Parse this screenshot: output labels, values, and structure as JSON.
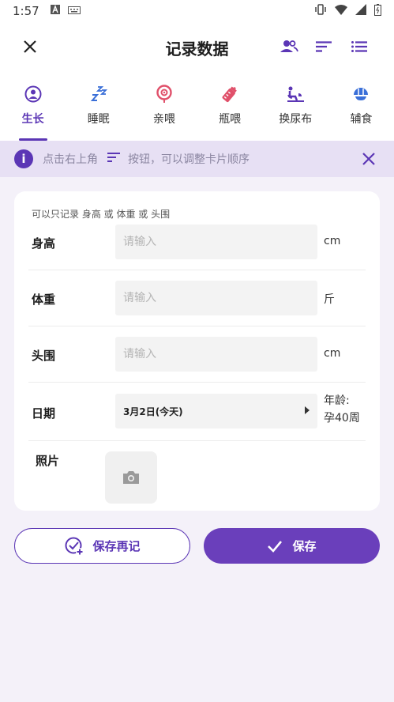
{
  "status_bar": {
    "time": "1:57"
  },
  "header": {
    "title": "记录数据",
    "icons": [
      "close-icon",
      "people-icon",
      "sort-icon",
      "list-icon"
    ]
  },
  "tabs": [
    {
      "label": "生长",
      "icon": "growth-icon",
      "active": true
    },
    {
      "label": "睡眠",
      "icon": "sleep-zzz-icon",
      "active": false
    },
    {
      "label": "亲喂",
      "icon": "breastfeed-icon",
      "active": false
    },
    {
      "label": "瓶喂",
      "icon": "bottle-icon",
      "active": false
    },
    {
      "label": "换尿布",
      "icon": "diaper-icon",
      "active": false
    },
    {
      "label": "辅食",
      "icon": "food-bowl-icon",
      "active": false
    }
  ],
  "tip": {
    "text_before": "点击右上角",
    "text_after": "按钮，可以调整卡片顺序"
  },
  "form": {
    "hint": "可以只记录 身高 或 体重 或 头围",
    "height": {
      "label": "身高",
      "placeholder": "请输入",
      "unit": "cm"
    },
    "weight": {
      "label": "体重",
      "placeholder": "请输入",
      "unit": "斤"
    },
    "head": {
      "label": "头围",
      "placeholder": "请输入",
      "unit": "cm"
    },
    "date": {
      "label": "日期",
      "value": "3月2日(今天)",
      "age_label": "年龄:",
      "age_value": "孕40周"
    },
    "photo": {
      "label": "照片"
    }
  },
  "buttons": {
    "save_again": "保存再记",
    "save": "保存"
  },
  "colors": {
    "accent": "#5b36b5",
    "tip_bg": "#e7e0f4",
    "page_bg": "#f4f1f9",
    "pink": "#e0506a"
  }
}
